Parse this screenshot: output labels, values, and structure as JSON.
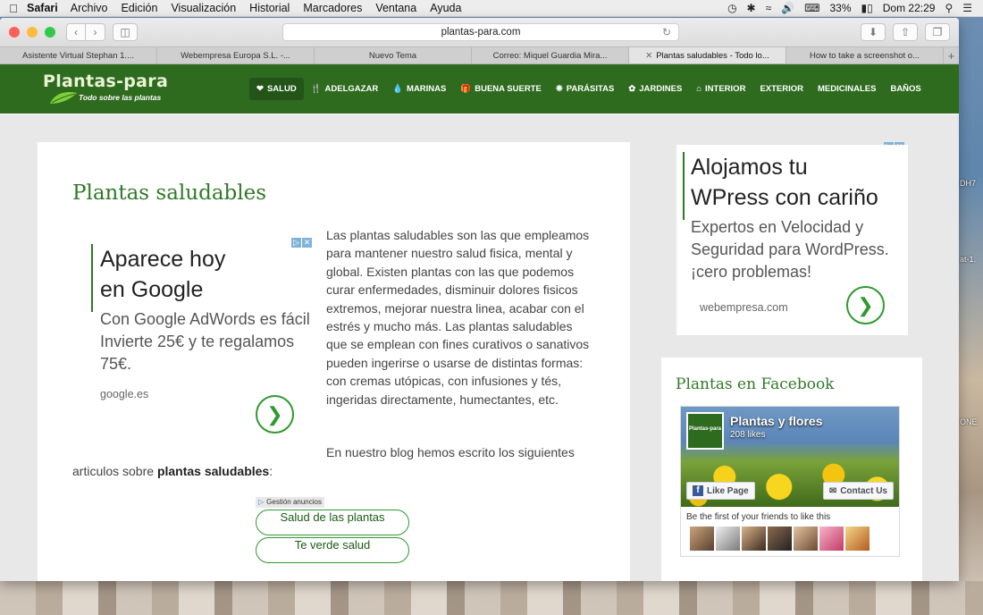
{
  "menubar": {
    "app_name": "Safari",
    "items": [
      "Archivo",
      "Edición",
      "Visualización",
      "Historial",
      "Marcadores",
      "Ventana",
      "Ayuda"
    ],
    "battery": "33%",
    "clock": "Dom 22:29"
  },
  "browser": {
    "url": "plantas-para.com",
    "tabs": [
      {
        "label": "Asistente Virtual Stephan 1....",
        "active": false
      },
      {
        "label": "Webempresa Europa S.L. -...",
        "active": false
      },
      {
        "label": "Nuevo Tema",
        "active": false
      },
      {
        "label": "Correo: Miquel Guardia Mira...",
        "active": false
      },
      {
        "label": "Plantas saludables - Todo lo...",
        "active": true
      },
      {
        "label": "How to take a screenshot o...",
        "active": false
      }
    ]
  },
  "site": {
    "logo_title": "Plantas-para",
    "logo_tagline": "Todo sobre las plantas",
    "nav": [
      {
        "label": "SALUD",
        "icon": "heart-icon",
        "active": true
      },
      {
        "label": "ADELGAZAR",
        "icon": "cutlery-icon",
        "active": false
      },
      {
        "label": "MARINAS",
        "icon": "drop-icon",
        "active": false
      },
      {
        "label": "BUENA SUERTE",
        "icon": "gift-icon",
        "active": false
      },
      {
        "label": "PARÁSITAS",
        "icon": "bug-icon",
        "active": false
      },
      {
        "label": "JARDINES",
        "icon": "leaf-icon",
        "active": false
      },
      {
        "label": "INTERIOR",
        "icon": "home-icon",
        "active": false
      },
      {
        "label": "EXTERIOR",
        "icon": "",
        "active": false
      },
      {
        "label": "MEDICINALES",
        "icon": "",
        "active": false
      },
      {
        "label": "BAÑOS",
        "icon": "",
        "active": false
      }
    ]
  },
  "article": {
    "title": "Plantas saludables",
    "intro": "Las plantas saludables son las que empleamos para mantener nuestro salud fisica, mental y global. Existen plantas con las que podemos curar enfermedades, disminuir dolores fisicos extremos, mejorar nuestra linea, acabar con el estrés y mucho más. Las plantas saludables que se emplean con fines curativos o sanativos pueden ingerirse o usarse de distintas formas: con cremas utópicas, con infusiones y tés, ingeridas directamente, humectantes, etc.",
    "blog_line_1": "En nuestro blog hemos escrito los siguientes",
    "blog_line_2_pre": "articulos sobre ",
    "blog_line_2_bold": "plantas saludables",
    "blog_line_2_post": ":",
    "ad": {
      "headline_1": "Aparece hoy",
      "headline_2": "en Google",
      "body": "Con Google AdWords es fácil Invierte 25€ y te regalamos 75€.",
      "url": "google.es"
    },
    "ad_links": {
      "label": "Gestión anuncios",
      "links": [
        "Salud de las plantas",
        "Te verde salud"
      ]
    }
  },
  "sidebar": {
    "ad": {
      "headline_1": "Alojamos tu",
      "headline_2": "WPress con cariño",
      "body": "Expertos en Velocidad y Seguridad para WordPress. ¡cero problemas!",
      "url": "webempresa.com"
    },
    "facebook": {
      "title": "Plantas en Facebook",
      "page_name": "Plantas y flores",
      "likes": "208 likes",
      "thumb_text": "Plantas-para",
      "like_button": "Like Page",
      "contact_button": "Contact Us",
      "friends_text": "Be the first of your friends to like this"
    }
  },
  "desktop_labels": [
    "DH7",
    "at-1.",
    "ONE"
  ]
}
